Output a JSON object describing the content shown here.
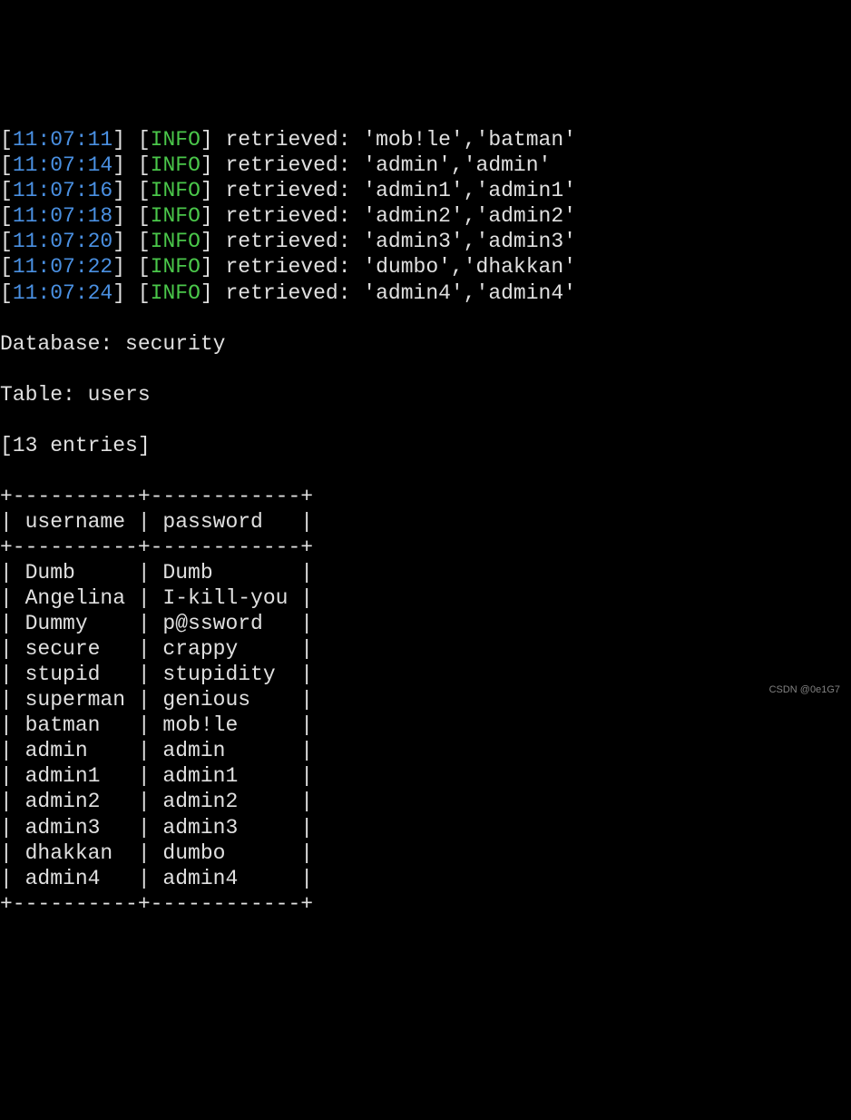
{
  "logs": [
    {
      "time": "11:07:11",
      "level": "INFO",
      "msg": "retrieved: 'mob!le','batman'"
    },
    {
      "time": "11:07:14",
      "level": "INFO",
      "msg": "retrieved: 'admin','admin'"
    },
    {
      "time": "11:07:16",
      "level": "INFO",
      "msg": "retrieved: 'admin1','admin1'"
    },
    {
      "time": "11:07:18",
      "level": "INFO",
      "msg": "retrieved: 'admin2','admin2'"
    },
    {
      "time": "11:07:20",
      "level": "INFO",
      "msg": "retrieved: 'admin3','admin3'"
    },
    {
      "time": "11:07:22",
      "level": "INFO",
      "msg": "retrieved: 'dumbo','dhakkan'"
    },
    {
      "time": "11:07:24",
      "level": "INFO",
      "msg": "retrieved: 'admin4','admin4'"
    }
  ],
  "database_label": "Database: security",
  "table_label": "Table: users",
  "entries_label": "[13 entries]",
  "table_border_top": "+----------+----------+",
  "table_header_username": "username",
  "table_header_password": "password",
  "rows": [
    {
      "username": "Dumb",
      "password": "Dumb"
    },
    {
      "username": "Angelina",
      "password": "I-kill-you"
    },
    {
      "username": "Dummy",
      "password": "p@ssword"
    },
    {
      "username": "secure",
      "password": "crappy"
    },
    {
      "username": "stupid",
      "password": "stupidity"
    },
    {
      "username": "superman",
      "password": "genious"
    },
    {
      "username": "batman",
      "password": "mob!le"
    },
    {
      "username": "admin",
      "password": "admin"
    },
    {
      "username": "admin1",
      "password": "admin1"
    },
    {
      "username": "admin2",
      "password": "admin2"
    },
    {
      "username": "admin3",
      "password": "admin3"
    },
    {
      "username": "dhakkan",
      "password": "dumbo"
    },
    {
      "username": "admin4",
      "password": "admin4"
    }
  ],
  "watermark": "CSDN @0e1G7"
}
